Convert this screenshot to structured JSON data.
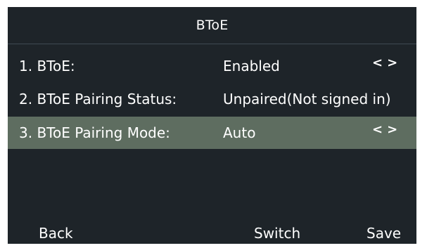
{
  "screen": {
    "title": "BToE"
  },
  "rows": [
    {
      "label": "1. BToE:",
      "value": "Enabled",
      "arrows": "<>"
    },
    {
      "label": "2. BToE Pairing Status:",
      "value": "Unpaired(Not signed in)"
    },
    {
      "label": "3. BToE Pairing Mode:",
      "value": "Auto",
      "arrows": "<>"
    }
  ],
  "softkeys": {
    "back": "Back",
    "switch": "Switch",
    "save": "Save"
  },
  "colors": {
    "screen_bg": "#1e2429",
    "selected_row_bg": "#5e6d60",
    "text": "#ffffff"
  }
}
